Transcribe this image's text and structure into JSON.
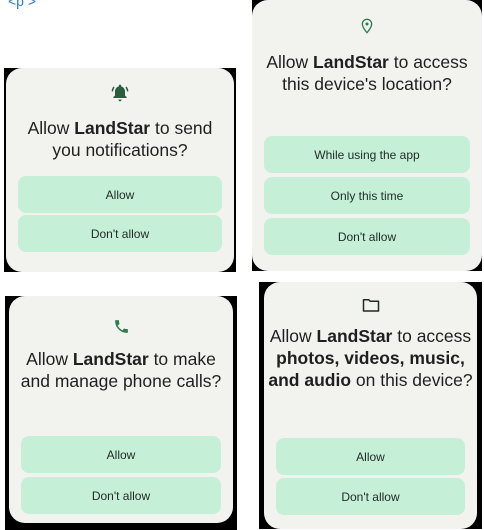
{
  "top_snippet": "<p         >        ",
  "dialogs": {
    "notifications": {
      "title_pre": "Allow ",
      "title_app": "LandStar",
      "title_post": " to send you notifications?",
      "buttons": [
        "Allow",
        "Don't allow"
      ]
    },
    "location": {
      "title_pre": "Allow ",
      "title_app": "LandStar",
      "title_post": " to access this device's location?",
      "buttons": [
        "While using the app",
        "Only this time",
        "Don't allow"
      ]
    },
    "phone": {
      "title_pre": "Allow ",
      "title_app": "LandStar",
      "title_post": " to make and manage phone calls?",
      "buttons": [
        "Allow",
        "Don't allow"
      ]
    },
    "media": {
      "title_pre": "Allow ",
      "title_app": "LandStar",
      "title_mid": " to access ",
      "title_bold_media": "photos, videos, music, and audio",
      "title_post": " on this device?",
      "buttons": [
        "Allow",
        "Don't allow"
      ]
    }
  },
  "colors": {
    "dialog_bg": "#f2f3ef",
    "button_bg": "#c6efd8",
    "icon_green": "#2e7d4f",
    "bell_icon": "#2b5e3f",
    "snippet_blue": "#2f79d2"
  },
  "icons": {
    "notifications": "bell-icon",
    "location": "location-pin-icon",
    "phone": "phone-icon",
    "media": "folder-icon"
  }
}
